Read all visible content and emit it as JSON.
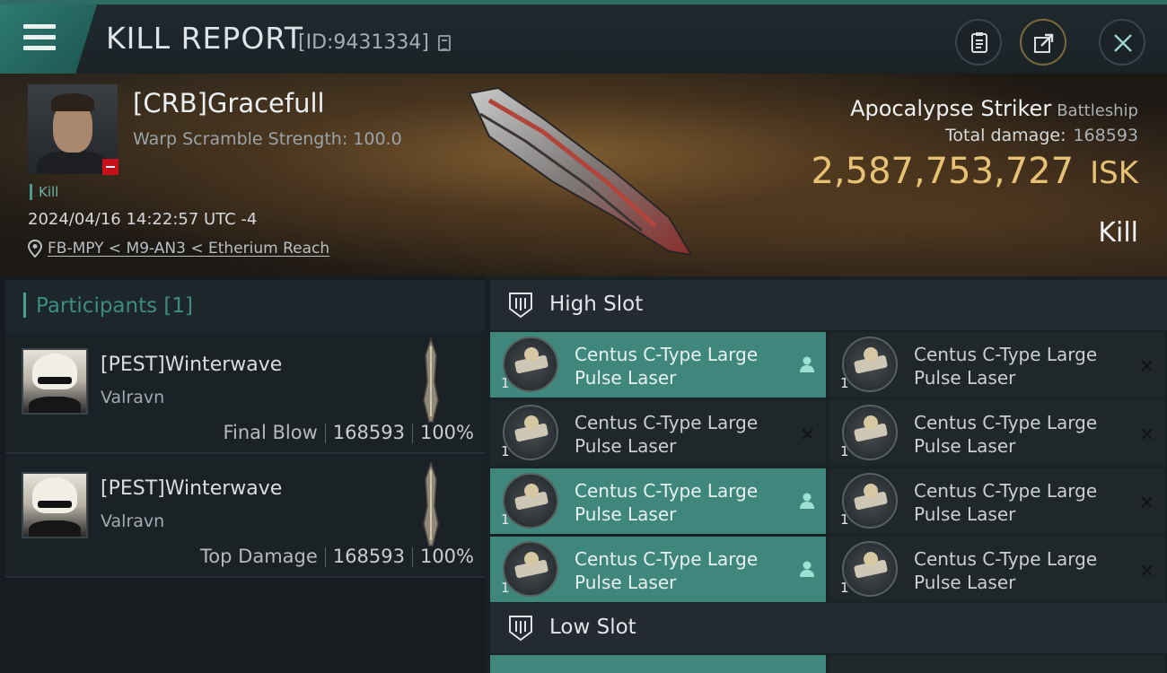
{
  "header": {
    "title": "KILL REPORT",
    "report_id": "[ID:9431334]"
  },
  "victim": {
    "name": "[CRB]Gracefull",
    "warp_scramble": "Warp Scramble Strength: 100.0",
    "kill_tag": "Kill",
    "timestamp": "2024/04/16 14:22:57 UTC -4",
    "location": "FB-MPY < M9-AN3 < Etherium Reach",
    "ship": "Apocalypse Striker",
    "ship_class": "Battleship",
    "total_damage_label": "Total damage:",
    "total_damage": "168593",
    "isk_value": "2,587,753,727",
    "isk_unit": "ISK",
    "result": "Kill"
  },
  "participants": {
    "header": "Participants [1]",
    "rows": [
      {
        "name": "[PEST]Winterwave",
        "ship": "Valravn",
        "label": "Final Blow",
        "damage": "168593",
        "percent": "100%"
      },
      {
        "name": "[PEST]Winterwave",
        "ship": "Valravn",
        "label": "Top Damage",
        "damage": "168593",
        "percent": "100%"
      }
    ]
  },
  "slots": {
    "high_label": "High Slot",
    "low_label": "Low Slot",
    "high_modules": [
      {
        "line1": "Centus C-Type Large",
        "line2": "Pulse Laser",
        "qty": "1",
        "status": "dropped"
      },
      {
        "line1": "Centus C-Type Large",
        "line2": "Pulse Laser",
        "qty": "1",
        "status": "destroyed"
      },
      {
        "line1": "Centus C-Type Large",
        "line2": "Pulse Laser",
        "qty": "1",
        "status": "destroyed"
      },
      {
        "line1": "Centus C-Type Large",
        "line2": "Pulse Laser",
        "qty": "1",
        "status": "destroyed"
      },
      {
        "line1": "Centus C-Type Large",
        "line2": "Pulse Laser",
        "qty": "1",
        "status": "dropped"
      },
      {
        "line1": "Centus C-Type Large",
        "line2": "Pulse Laser",
        "qty": "1",
        "status": "destroyed"
      },
      {
        "line1": "Centus C-Type Large",
        "line2": "Pulse Laser",
        "qty": "1",
        "status": "dropped"
      },
      {
        "line1": "Centus C-Type Large",
        "line2": "Pulse Laser",
        "qty": "1",
        "status": "destroyed"
      }
    ],
    "status_icons": {
      "dropped": "person-icon",
      "destroyed": "x-icon"
    }
  },
  "colors": {
    "accent": "#3f877d",
    "isk": "#e7c174",
    "loss_badge": "#c8101a"
  }
}
